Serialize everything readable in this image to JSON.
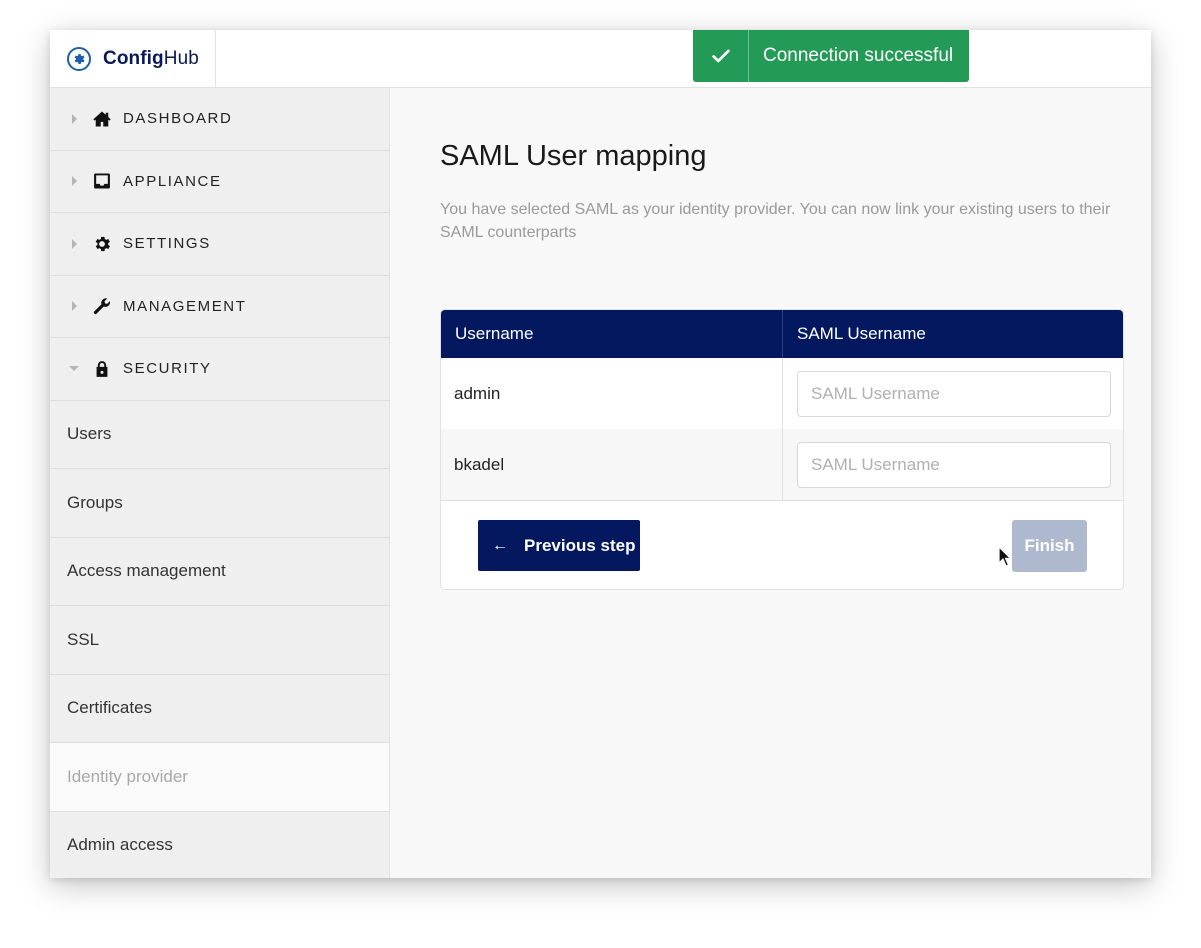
{
  "app": {
    "logo": {
      "bold": "Config",
      "regular": "Hub"
    }
  },
  "toast": {
    "message": "Connection successful",
    "color": "#239b56"
  },
  "sidebar": {
    "groups": [
      {
        "label": "DASHBOARD",
        "icon": "home-icon",
        "expanded": false
      },
      {
        "label": "APPLIANCE",
        "icon": "inbox-icon",
        "expanded": false
      },
      {
        "label": "SETTINGS",
        "icon": "gear-icon",
        "expanded": false
      },
      {
        "label": "MANAGEMENT",
        "icon": "wrench-icon",
        "expanded": false
      },
      {
        "label": "SECURITY",
        "icon": "lock-icon",
        "expanded": true
      }
    ],
    "security_items": [
      {
        "label": "Users"
      },
      {
        "label": "Groups"
      },
      {
        "label": "Access management"
      },
      {
        "label": "SSL"
      },
      {
        "label": "Certificates"
      },
      {
        "label": "Identity provider",
        "active": true
      },
      {
        "label": "Admin access"
      }
    ]
  },
  "main": {
    "title": "SAML User mapping",
    "description": "You have selected SAML as your identity provider. You can now link your existing users to their SAML counterparts",
    "table": {
      "columns": [
        "Username",
        "SAML Username"
      ],
      "rows": [
        {
          "username": "admin",
          "saml_value": "",
          "saml_placeholder": "SAML Username"
        },
        {
          "username": "bkadel",
          "saml_value": "",
          "saml_placeholder": "SAML Username"
        }
      ]
    },
    "buttons": {
      "previous": "Previous step",
      "finish": "Finish",
      "finish_disabled": true
    }
  },
  "colors": {
    "primary": "#03185e",
    "success": "#239b56",
    "finish_disabled": "#aeb9cf"
  }
}
